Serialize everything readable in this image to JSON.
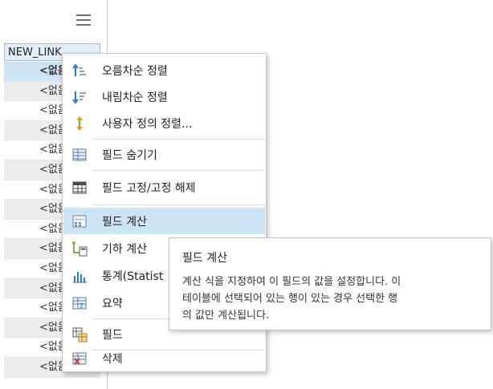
{
  "table": {
    "header": "NEW_LINK",
    "rows": [
      "<없음>",
      "<없음>",
      "<없음>",
      "<없음>",
      "<없음>",
      "<없음>",
      "<없음>",
      "<없음>",
      "<없음>",
      "<없음>",
      "<없음>",
      "<없음>",
      "<없음>",
      "<없음>",
      "<없음>",
      "<없음>"
    ]
  },
  "menu": {
    "items": [
      {
        "label": "오름차순 정렬",
        "icon": "sort-ascending-icon"
      },
      {
        "label": "내림차순 정렬",
        "icon": "sort-descending-icon"
      },
      {
        "label": "사용자 정의 정렬...",
        "icon": "custom-sort-icon"
      },
      {
        "label": "필드 숨기기",
        "icon": "hide-field-icon"
      },
      {
        "label": "필드 고정/고정 해제",
        "icon": "freeze-field-icon"
      },
      {
        "label": "필드 계산",
        "icon": "calculate-field-icon"
      },
      {
        "label": "기하 계산",
        "icon": "calculate-geometry-icon"
      },
      {
        "label": "통계(Statist",
        "icon": "statistics-icon"
      },
      {
        "label": "요약",
        "icon": "summarize-icon"
      },
      {
        "label": "필드",
        "icon": "fields-icon"
      },
      {
        "label": "삭제",
        "icon": "delete-icon"
      }
    ]
  },
  "tooltip": {
    "title": "필드 계산",
    "line1": "계산 식을 지정하여 이 필드의 값을 설정합니다. 이",
    "line2": "테이블에 선택되어 있는 행이 있는 경우 선택한 행",
    "line3": "의 값만 계산됩니다."
  },
  "colors": {
    "hover": "#cde4f7",
    "accent": "#0078d7"
  }
}
